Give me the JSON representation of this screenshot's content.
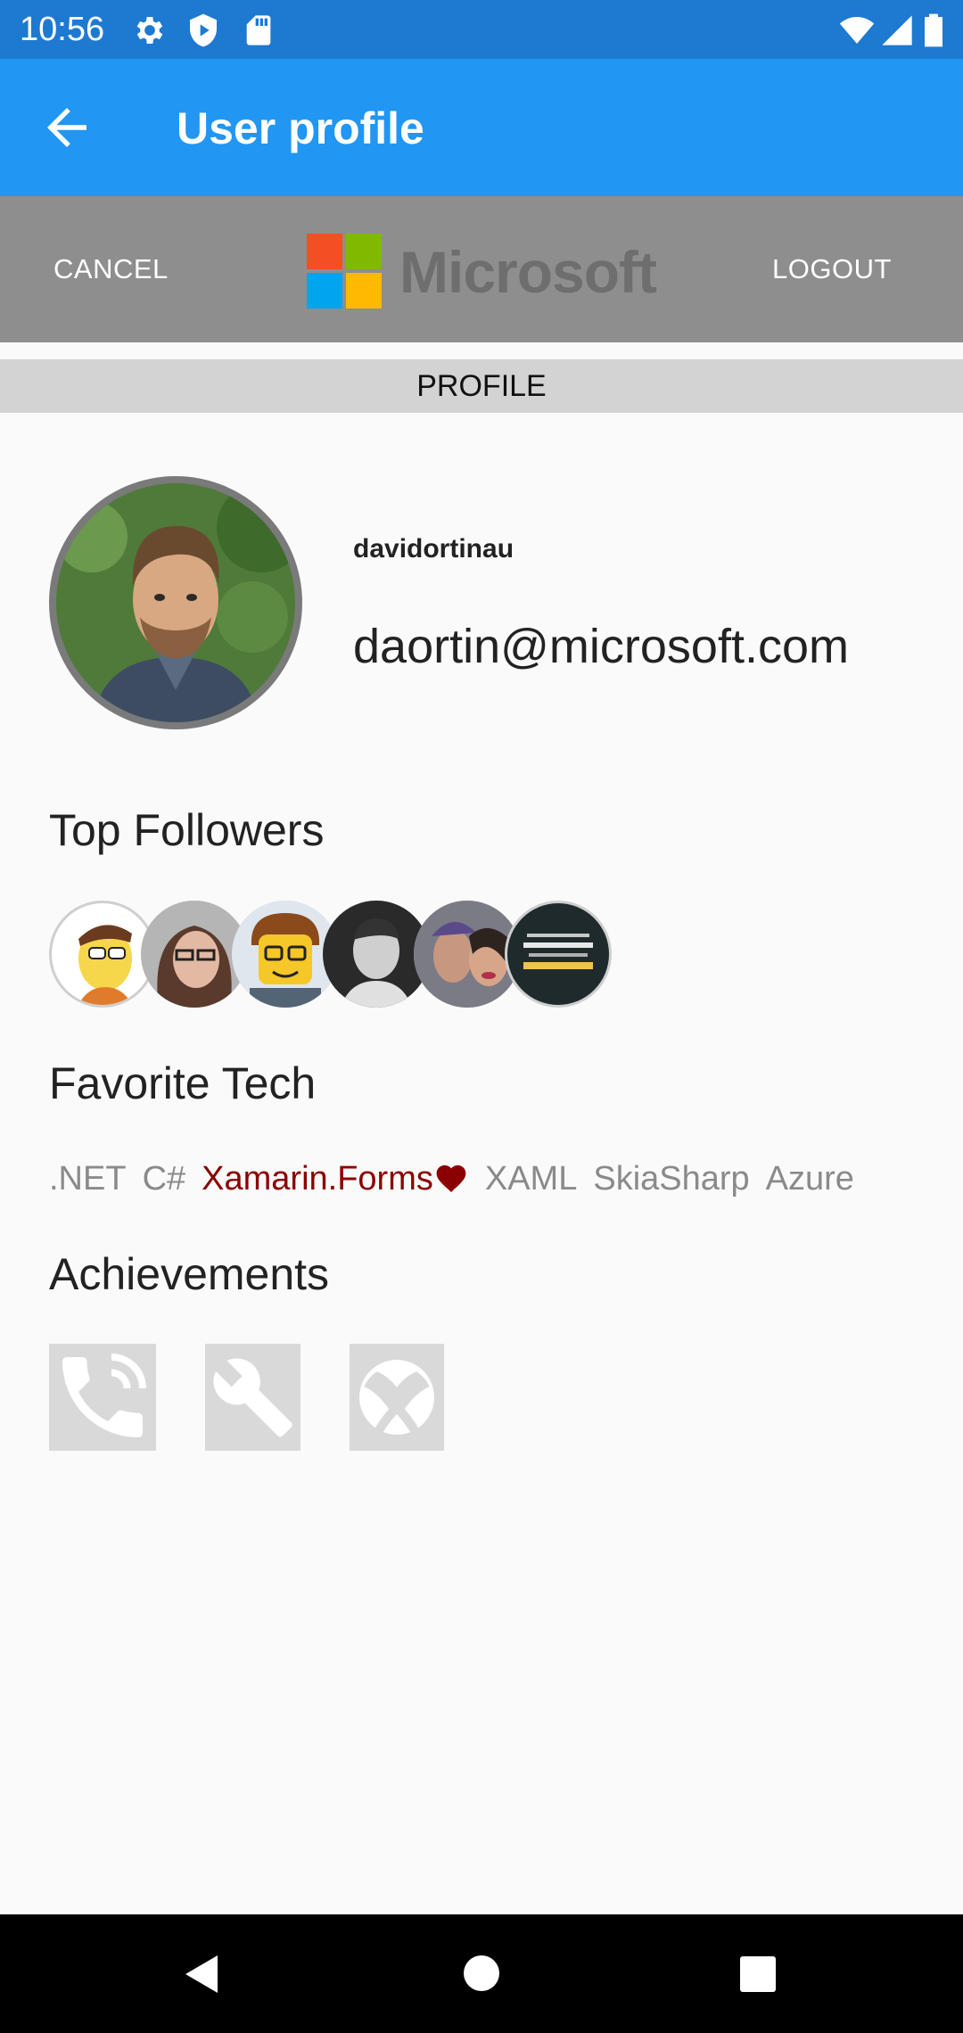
{
  "status_bar": {
    "time": "10:56",
    "icons": [
      "gear-icon",
      "shield-play-icon",
      "sd-card-icon",
      "wifi-icon",
      "cell-signal-icon",
      "battery-icon"
    ]
  },
  "app_bar": {
    "title": "User profile",
    "back_icon": "arrow-left-icon"
  },
  "toolbar": {
    "cancel_label": "CANCEL",
    "logout_label": "LOGOUT",
    "logo_text": "Microsoft"
  },
  "tabs": [
    {
      "label": "PROFILE",
      "selected": true
    }
  ],
  "profile": {
    "username": "davidortinau",
    "email": "daortin@microsoft.com"
  },
  "sections": {
    "top_followers": "Top Followers",
    "favorite_tech": "Favorite Tech",
    "achievements": "Achievements"
  },
  "followers_count_shown": 6,
  "favorite_tech": [
    {
      "label": ".NET",
      "favorite": false
    },
    {
      "label": "C#",
      "favorite": false
    },
    {
      "label": "Xamarin.Forms",
      "favorite": true
    },
    {
      "label": "XAML",
      "favorite": false
    },
    {
      "label": "SkiaSharp",
      "favorite": false
    },
    {
      "label": "Azure",
      "favorite": false
    }
  ],
  "favorite_color": "#8b0000",
  "achievements": [
    "phone-call-icon",
    "wrench-icon",
    "xbox-icon"
  ],
  "nav_bar": [
    "back-triangle-icon",
    "home-circle-icon",
    "recents-square-icon"
  ],
  "colors": {
    "status_bar": "#1e79d1",
    "app_bar": "#2196f3",
    "toolbar": "#8e8e8e",
    "tab_bar": "#d3d3d3"
  }
}
